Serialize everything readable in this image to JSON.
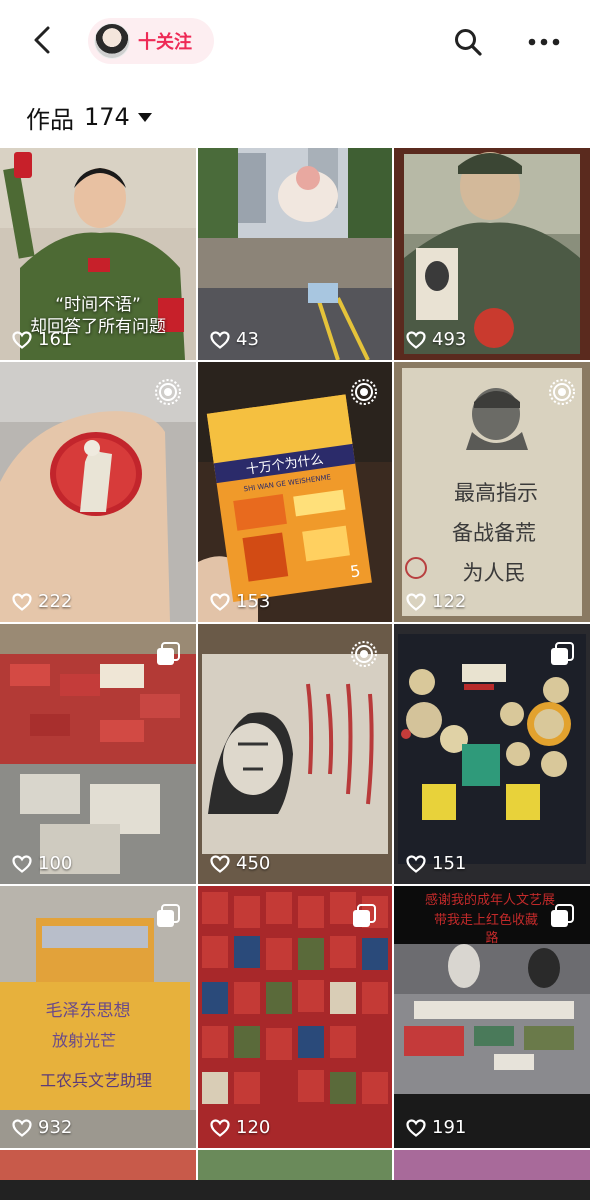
{
  "header": {
    "follow_label": "十关注",
    "icons": {
      "back": "chevron-left-icon",
      "search": "search-icon",
      "more": "more-dots-icon"
    }
  },
  "works": {
    "label": "作品",
    "count": "174"
  },
  "tiles": [
    {
      "likes": "161",
      "caption_line1": "“时间不语”",
      "caption_line2": "却回答了所有问题",
      "type": "none"
    },
    {
      "likes": "43",
      "type": "none"
    },
    {
      "likes": "493",
      "type": "none"
    },
    {
      "likes": "222",
      "type": "live"
    },
    {
      "likes": "153",
      "type": "live",
      "book_title": "十万个为什么",
      "book_sub": "SHI WAN GE WEISHENME"
    },
    {
      "likes": "122",
      "type": "live",
      "sign_line1": "最高指示",
      "sign_line2": "备战备荒",
      "sign_line3": "为人民"
    },
    {
      "likes": "100",
      "type": "album"
    },
    {
      "likes": "450",
      "type": "live"
    },
    {
      "likes": "151",
      "type": "album"
    },
    {
      "likes": "932",
      "type": "album",
      "box_line1": "毛泽东思想",
      "box_line2": "放射光芒",
      "box_line3": "工农兵文艺助理"
    },
    {
      "likes": "120",
      "type": "album"
    },
    {
      "likes": "191",
      "type": "album",
      "banner_line1": "感谢我的成年人文艺展",
      "banner_line2": "带我走上红色收藏",
      "banner_line3": "路"
    }
  ],
  "colors": {
    "accent": "#ee2a56",
    "chip_bg": "#fdeef1"
  }
}
